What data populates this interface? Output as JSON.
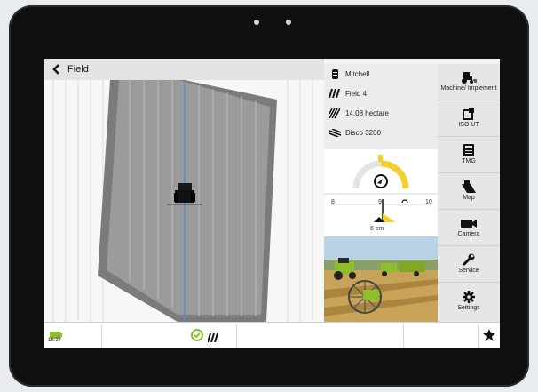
{
  "header": {
    "title": "Field"
  },
  "info": {
    "operator": "Mitchell",
    "field": "Field 4",
    "area": "14.08 hectare",
    "implement": "Disco 3200"
  },
  "guidance": {
    "scale_left": "8",
    "scale_mid": "9",
    "scale_right": "10",
    "offset": "6 cm"
  },
  "sidebar": {
    "items": [
      {
        "label": "Machine/ Implement",
        "icon": "tractor-icon"
      },
      {
        "label": "ISO UT",
        "icon": "iso-ut-icon"
      },
      {
        "label": "TMG",
        "icon": "tmg-icon"
      },
      {
        "label": "Map",
        "icon": "map-icon"
      },
      {
        "label": "Camera",
        "icon": "camera-icon"
      },
      {
        "label": "Service",
        "icon": "wrench-icon"
      },
      {
        "label": "Settings",
        "icon": "gear-icon"
      }
    ]
  },
  "statusbar": {
    "time": "16:27"
  },
  "colors": {
    "accent": "#f2cf2f",
    "guide_line": "#4b8fd6",
    "swath_dark": "#6b6b6b",
    "swath_light": "#9a9a9a",
    "bezel": "#0f0f10"
  }
}
